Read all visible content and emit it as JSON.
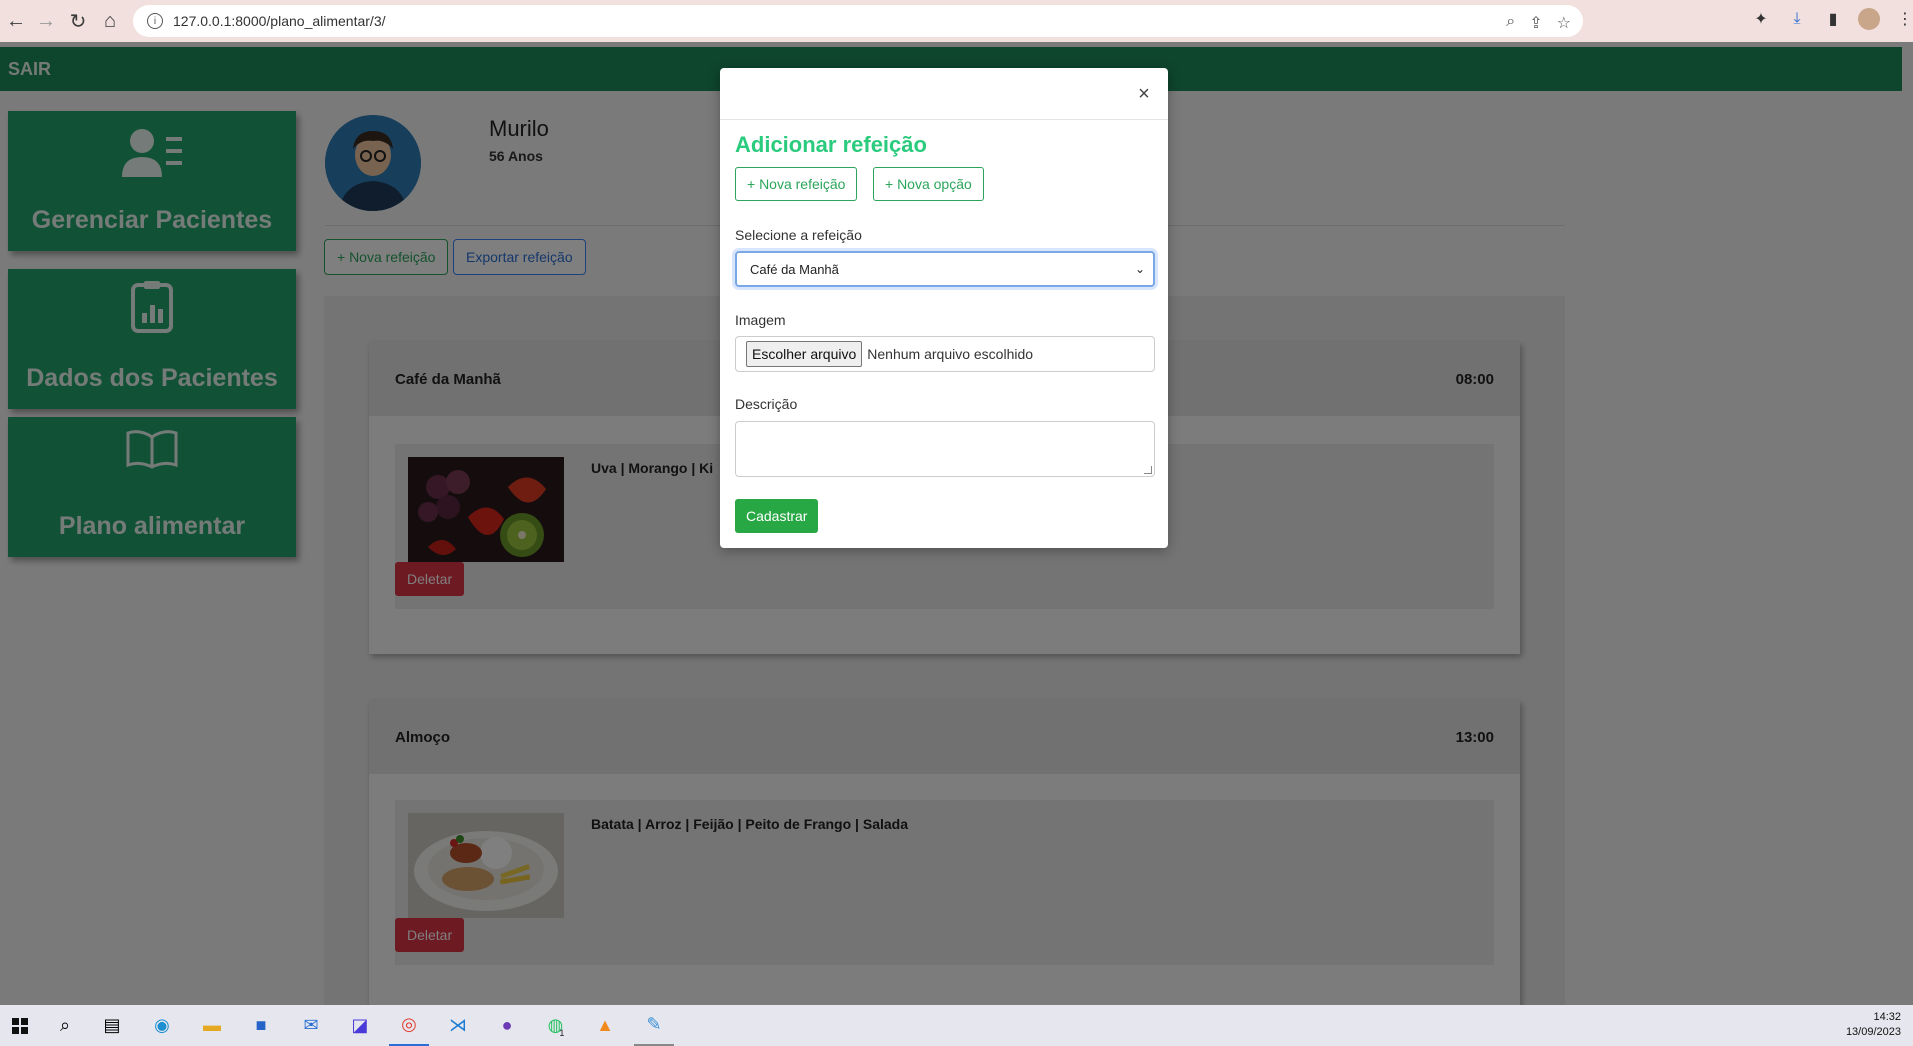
{
  "browser": {
    "url": "127.0.0.1:8000/plano_alimentar/3/"
  },
  "nav": {
    "logout": "SAIR"
  },
  "sidebar": {
    "items": [
      {
        "label": "Gerenciar Pacientes"
      },
      {
        "label": "Dados dos Pacientes"
      },
      {
        "label": "Plano alimentar"
      }
    ]
  },
  "patient": {
    "name": "Murilo",
    "age": "56 Anos"
  },
  "actions": {
    "new_meal": "+ Nova refeição",
    "export_meal": "Exportar refeição"
  },
  "meals": [
    {
      "name": "Café da Manhã",
      "time": "08:00",
      "items": [
        {
          "description": "Uva | Morango | Ki",
          "delete": "Deletar"
        }
      ]
    },
    {
      "name": "Almoço",
      "time": "13:00",
      "items": [
        {
          "description": "Batata | Arroz | Feijão | Peito de Frango | Salada",
          "delete": "Deletar"
        }
      ]
    }
  ],
  "modal": {
    "close": "×",
    "title": "Adicionar refeição",
    "new_meal_btn": "+ Nova refeição",
    "new_option_btn": "+ Nova opção",
    "select_label": "Selecione a refeição",
    "select_value": "Café da Manhã",
    "image_label": "Imagem",
    "file_button": "Escolher arquivo",
    "file_status": "Nenhum arquivo escolhido",
    "description_label": "Descrição",
    "submit": "Cadastrar"
  },
  "taskbar": {
    "time": "14:32",
    "date": "13/09/2023",
    "badge": "1"
  },
  "colors": {
    "brand": "#1d8a5b",
    "card": "#22a56d",
    "accent": "#2bcb7e",
    "danger": "#dc3545",
    "primary": "#3b82f6"
  }
}
